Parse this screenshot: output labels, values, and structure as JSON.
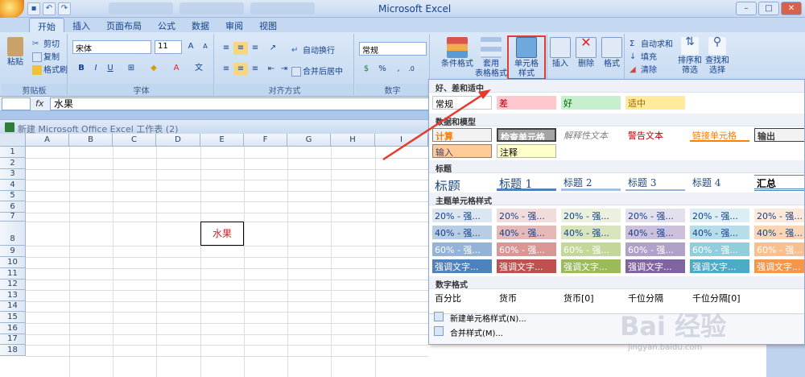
{
  "window": {
    "app_title": "Microsoft Excel",
    "workbook_title": "新建 Microsoft Office Excel 工作表 (2)"
  },
  "ribbon_tabs": [
    "开始",
    "插入",
    "页面布局",
    "公式",
    "数据",
    "审阅",
    "视图"
  ],
  "clipboard": {
    "paste": "粘贴",
    "cut": "剪切",
    "copy": "复制",
    "format_painter": "格式刷",
    "label": "剪贴板"
  },
  "font": {
    "name": "宋体",
    "size": "11",
    "bold": "B",
    "italic": "I",
    "underline": "U",
    "label": "字体"
  },
  "alignment": {
    "wrap_text": "自动换行",
    "merge_center": "合并后居中",
    "label": "对齐方式"
  },
  "number": {
    "format": "常规",
    "label": "数字"
  },
  "styles": {
    "conditional_format": "条件格式",
    "table_format": "套用\n表格格式",
    "cell_styles": "单元格\n样式"
  },
  "cells": {
    "insert": "插入",
    "delete": "删除",
    "format": "格式"
  },
  "editing": {
    "autosum": "自动求和",
    "fill": "填充",
    "clear": "清除",
    "sort_filter": "排序和\n筛选",
    "find_select": "查找和\n选择"
  },
  "formula_bar": {
    "fx": "fx",
    "value": "水果"
  },
  "sheet": {
    "columns": [
      "A",
      "B",
      "C",
      "D",
      "E",
      "F",
      "G",
      "H",
      "I"
    ],
    "rows": [
      "1",
      "2",
      "3",
      "4",
      "5",
      "6",
      "7",
      "8",
      "9",
      "10",
      "11",
      "12",
      "13",
      "14",
      "15",
      "16",
      "17",
      "18"
    ],
    "cell_value": "水果"
  },
  "gallery": {
    "sections": {
      "good_bad": "好、差和适中",
      "data_model": "数据和模型",
      "titles": "标题",
      "theme": "主题单元格样式",
      "number_format": "数字格式"
    },
    "good_bad": [
      "常规",
      "差",
      "好",
      "适中"
    ],
    "data_model_row1": [
      "计算",
      "检查单元格",
      "解释性文本",
      "警告文本",
      "链接单元格",
      "输出"
    ],
    "data_model_row2": [
      "输入",
      "注释"
    ],
    "titles": [
      "标题",
      "标题 1",
      "标题 2",
      "标题 3",
      "标题 4",
      "汇总"
    ],
    "theme_20": [
      "20% - 强...",
      "20% - 强...",
      "20% - 强...",
      "20% - 强...",
      "20% - 强...",
      "20% - 强..."
    ],
    "theme_40": [
      "40% - 强...",
      "40% - 强...",
      "40% - 强...",
      "40% - 强...",
      "40% - 强...",
      "40% - 强..."
    ],
    "theme_60": [
      "60% - 强...",
      "60% - 强...",
      "60% - 强...",
      "60% - 强...",
      "60% - 强...",
      "60% - 强..."
    ],
    "theme_accent": [
      "强调文字...",
      "强调文字...",
      "强调文字...",
      "强调文字...",
      "强调文字...",
      "强调文字..."
    ],
    "number_formats": [
      "百分比",
      "货币",
      "货币[0]",
      "千位分隔",
      "千位分隔[0]"
    ],
    "new_style": "新建单元格样式(N)...",
    "merge_styles": "合并样式(M)..."
  },
  "watermark": {
    "brand": "Bai 经验",
    "url": "jingyan.baidu.com"
  }
}
